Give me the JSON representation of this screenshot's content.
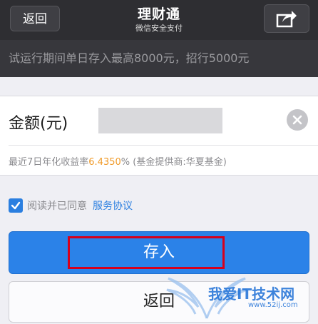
{
  "header": {
    "back_label": "返回",
    "title": "理财通",
    "subtitle": "微信安全支付",
    "share_icon": "share-icon"
  },
  "notice": {
    "text": "试运行期间单日存入最高8000元，招行5000元"
  },
  "form": {
    "amount_label": "金额(元)",
    "amount_value": "",
    "clear_icon": "clear-icon",
    "yield_prefix": "最近7日年化收益率",
    "yield_rate": "6.4350",
    "yield_suffix": "% (基金提供商:华夏基金)"
  },
  "agreement": {
    "checked": true,
    "text": "阅读并已同意",
    "link": "服务协议"
  },
  "buttons": {
    "deposit": "存入",
    "return": "返回"
  },
  "watermark": {
    "text": "我爱IT技术网",
    "url": "www.52ij.com"
  },
  "colors": {
    "header_bg": "#2e2e32",
    "primary": "#2b82e8",
    "rate": "#f09b2a",
    "highlight": "#d6001c"
  }
}
